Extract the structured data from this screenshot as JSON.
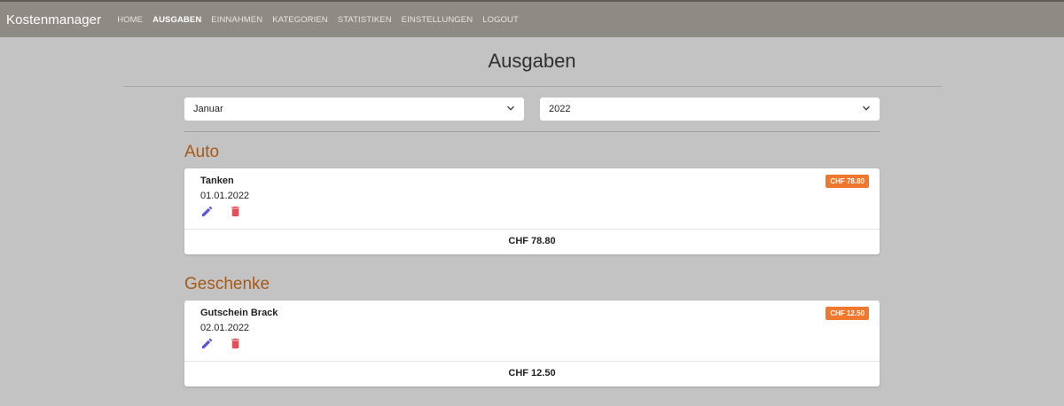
{
  "app": {
    "brand": "Kostenmanager"
  },
  "nav": {
    "items": [
      {
        "label": "HOME"
      },
      {
        "label": "AUSGABEN"
      },
      {
        "label": "EINNAHMEN"
      },
      {
        "label": "KATEGORIEN"
      },
      {
        "label": "STATISTIKEN"
      },
      {
        "label": "EINSTELLUNGEN"
      },
      {
        "label": "LOGOUT"
      }
    ],
    "active": "AUSGABEN"
  },
  "page": {
    "title": "Ausgaben"
  },
  "filters": {
    "month": {
      "value": "Januar"
    },
    "year": {
      "value": "2022"
    }
  },
  "categories": [
    {
      "name": "Auto",
      "expense": {
        "name": "Tanken",
        "date": "01.01.2022",
        "badge": "CHF 78.80"
      },
      "total": "CHF 78.80"
    },
    {
      "name": "Geschenke",
      "expense": {
        "name": "Gutschein Brack",
        "date": "02.01.2022",
        "badge": "CHF 12.50"
      },
      "total": "CHF 12.50"
    }
  ],
  "colors": {
    "navbar": "#8e8a84",
    "background": "#c3c3c3",
    "category_heading": "#a55a1a",
    "badge": "#f0772e",
    "edit_icon": "#5b55d8",
    "delete_icon": "#e0505a"
  },
  "icons": {
    "edit": "pencil-icon",
    "delete": "trash-icon",
    "select_caret": "chevron-down-icon"
  }
}
